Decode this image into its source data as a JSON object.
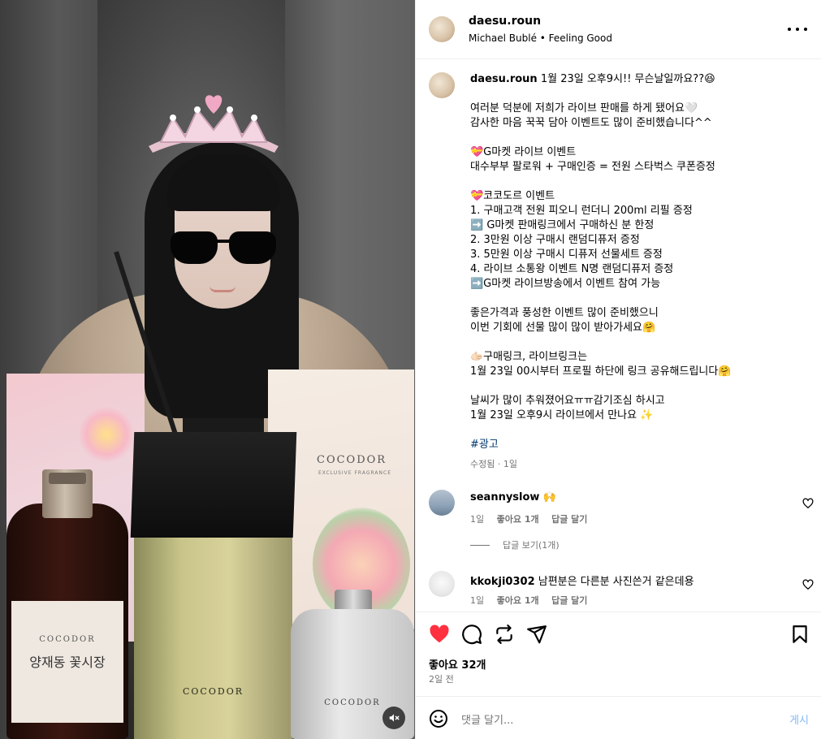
{
  "post": {
    "username": "daesu.roun",
    "audio": "Michael Bublé • Feeling Good",
    "caption": {
      "username": "daesu.roun",
      "text": "1월 23일 오후9시!! 무슨날일까요??😆\n\n여러분 덕분에 저희가 라이브 판매를 하게 됐어요🤍\n감사한 마음 꾹꾹 담아 이벤트도 많이 준비했습니다^^\n\n💝G마켓 라이브 이벤트\n대수부부 팔로워 + 구매인증 = 전원 스타벅스 쿠폰증정\n\n💝코코도르 이벤트\n1. 구매고객 전원 피오니 런더니 200ml 리필 증정\n➡️ G마켓 판매링크에서 구매하신 분 한정\n2. 3만원 이상 구매시 랜덤디퓨저 증정\n3. 5만원 이상 구매시 디퓨저 선물세트 증정\n4. 라이브 소통왕 이벤트 N명 랜덤디퓨저 증정\n➡️G마켓 라이브방송에서 이벤트 참여 가능\n\n좋은가격과 풍성한 이벤트 많이 준비했으니\n이번 기회에 선물 많이 많이 받아가세요🤗\n\n🫱🏻구매링크, 라이브링크는\n1월 23일 00시부터 프로필 하단에 링크 공유해드립니다🤗\n\n날씨가 많이 추워졌어요ㅠㅠ감기조심 하시고\n1월 23일 오후9시 라이브에서 만나요 ✨",
      "hashtag": "#광고",
      "edited": "수정됨 · 1일"
    },
    "comments": [
      {
        "username": "seannyslow",
        "text": "🙌",
        "time": "1일",
        "likes": "좋아요 1개",
        "reply": "답글 달기",
        "view_replies": "답글 보기(1개)"
      },
      {
        "username": "kkokji0302",
        "text": "남편분은 다른분 사진쓴거 같은데용",
        "time": "1일",
        "likes": "좋아요 1개",
        "reply": "답글 달기"
      }
    ],
    "likes_count": "좋아요 32개",
    "posted_ago": "2일 전",
    "comment_placeholder": "댓글 달기...",
    "post_button": "게시"
  },
  "media": {
    "box_brand": "COCODOR",
    "box_subtitle": "EXCLUSIVE FRAGRANCE",
    "bottle_label_brand": "COCODOR",
    "bottle_label_name": "양재동 꽃시장",
    "diffuser_brand": "COCODOR",
    "clear_bottle_brand": "COCODOR"
  },
  "colors": {
    "like_red": "#ff3040",
    "hashtag_blue": "#00376b",
    "post_button_blue": "#85b8f5",
    "secondary_text": "#737373"
  },
  "icons": [
    "more-icon",
    "heart-icon",
    "comment-icon",
    "share-icon",
    "send-icon",
    "bookmark-icon",
    "emoji-icon",
    "mute-icon"
  ]
}
